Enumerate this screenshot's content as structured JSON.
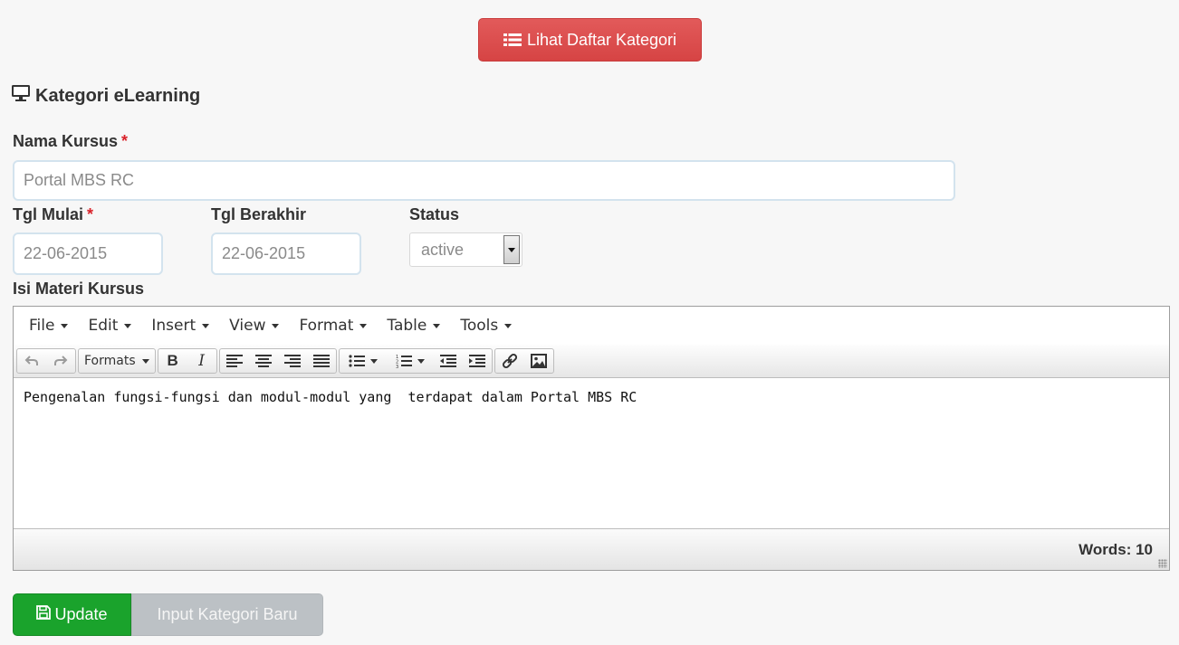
{
  "header": {
    "list_button_label": "Lihat Daftar Kategori",
    "list_icon": "list-icon"
  },
  "section": {
    "title": "Kategori eLearning",
    "icon": "monitor-icon"
  },
  "form": {
    "nama_kursus": {
      "label": "Nama Kursus",
      "required_mark": "*",
      "value": "Portal MBS RC"
    },
    "tgl_mulai": {
      "label": "Tgl Mulai",
      "required_mark": "*",
      "value": "22-06-2015"
    },
    "tgl_berakhir": {
      "label": "Tgl Berakhir",
      "value": "22-06-2015"
    },
    "status": {
      "label": "Status",
      "selected": "active"
    },
    "isi_materi": {
      "label": "Isi Materi Kursus"
    }
  },
  "editor": {
    "menus": [
      "File",
      "Edit",
      "Insert",
      "View",
      "Format",
      "Table",
      "Tools"
    ],
    "formats_label": "Formats",
    "bold_label": "B",
    "italic_label": "I",
    "content": "Pengenalan fungsi-fungsi dan modul-modul yang  terdapat dalam Portal MBS RC",
    "word_count": "Words: 10"
  },
  "actions": {
    "update_label": "Update",
    "new_label": "Input Kategori Baru",
    "update_icon": "save-icon"
  },
  "colors": {
    "danger": "#dd4b4b",
    "success": "#1aa32c",
    "disabled": "#bcc1c5",
    "required": "#d9222a"
  }
}
